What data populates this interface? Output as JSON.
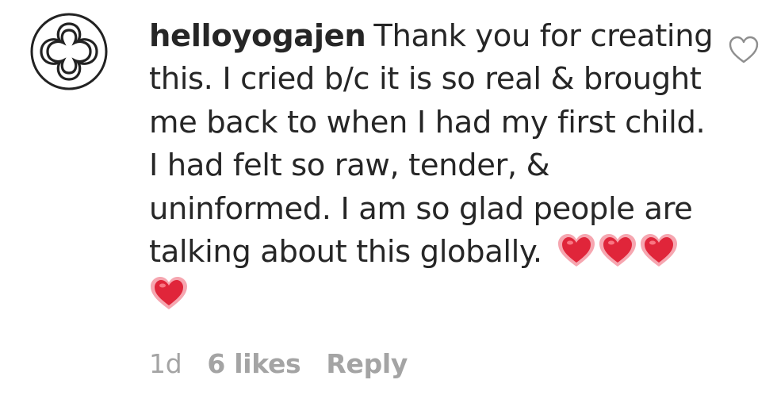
{
  "comment": {
    "username": "helloyogajen",
    "text_lines": [
      "Thank you for creating",
      "this. I cried b/c it is so real & brought",
      "me back to when I had my first child.",
      "I had felt so raw, tender, &",
      "uninformed. I am so glad people are",
      "talking about this globally."
    ],
    "emojis": [
      "heart-emoji",
      "heart-emoji",
      "heart-emoji",
      "heart-emoji"
    ],
    "timestamp": "1d",
    "likes": "6 likes",
    "reply_label": "Reply",
    "like_icon": "heart-outline-icon"
  },
  "colors": {
    "text": "#262626",
    "meta": "#a4a4a4",
    "emoji_heart": "#e0253a"
  }
}
